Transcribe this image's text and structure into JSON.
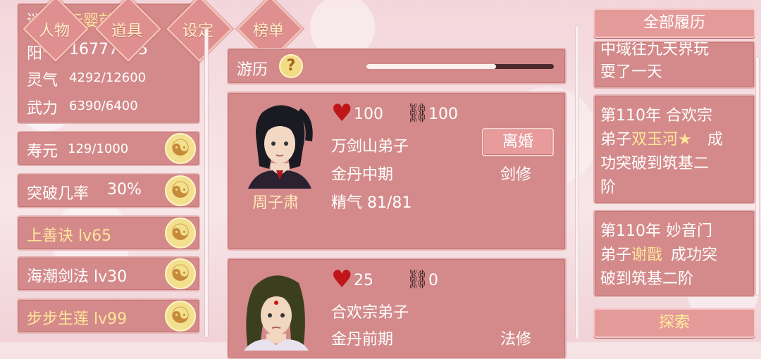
{
  "top_nav": {
    "character": "人物",
    "items": "道具",
    "settings": "设定",
    "ranking": "榜单"
  },
  "profile": {
    "partial_line1_a": "迷误",
    "partial_line1_b": "元婴前期",
    "partial_line2_label": "阳气",
    "partial_line2_value": "16777215",
    "spirit_label": "灵气",
    "spirit_value": "4292/12600",
    "force_label": "武力",
    "force_value": "6390/6400"
  },
  "stats": [
    {
      "label": "寿元",
      "value": "129/1000"
    },
    {
      "label": "突破几率",
      "value": "30%"
    }
  ],
  "skills": [
    {
      "label": "上善诀 lv65"
    },
    {
      "label": "海潮剑法 lv30"
    },
    {
      "label": "步步生莲 lv99"
    }
  ],
  "travel": {
    "label": "游历",
    "help_icon": "?",
    "progress": 0.6
  },
  "companions": [
    {
      "name": "周子肃",
      "hearts": "100",
      "bonds": "100",
      "sect": "万剑山弟子",
      "realm": "金丹中期",
      "essence": "精气 81/81",
      "path": "剑修",
      "action": "离婚"
    },
    {
      "hearts": "25",
      "bonds": "0",
      "sect": "合欢宗弟子",
      "realm": "金丹前期",
      "path": "法修"
    }
  ],
  "history": {
    "title": "全部履历",
    "entry0_lines": [
      "中域往九天界玩",
      "耍了一天"
    ],
    "entry1": {
      "a": "第110年 合欢宗",
      "b": "弟子",
      "hl": "双玉河★",
      "c": "成",
      "d": "功突破到筑基二",
      "e": "阶"
    },
    "entry2": {
      "a": "第110年 妙音门",
      "b": "弟子",
      "hl": "谢戬",
      "c": "成功突",
      "d": "破到筑基二阶"
    },
    "explore": "探索"
  },
  "colors": {
    "panel": "#d48a8a",
    "highlight_name": "#ffe59a",
    "heart": "#c0161a"
  },
  "icons": [
    "yin-yang-icon",
    "heart-icon",
    "handcuff-icon",
    "help-icon"
  ]
}
